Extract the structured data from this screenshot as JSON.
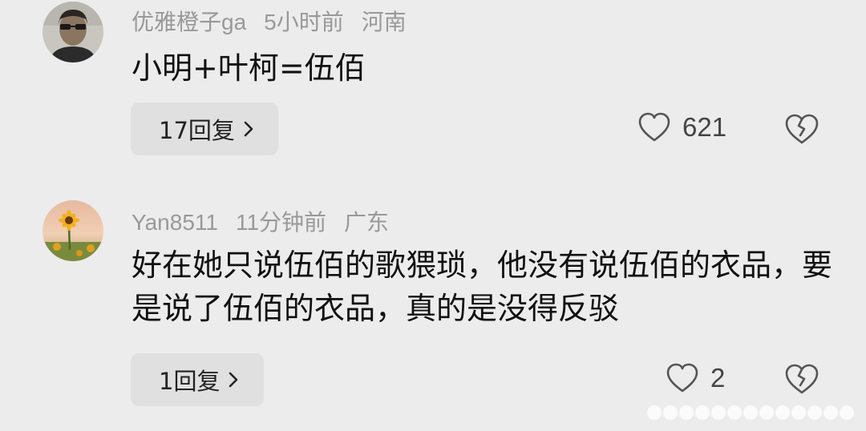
{
  "comments": [
    {
      "username": "优雅橙子ga",
      "time": "5小时前",
      "location": "河南",
      "text": "小明+叶柯=伍佰",
      "reply_label": "17回复",
      "likes": "621",
      "avatar_icon": "man-sunglasses-avatar"
    },
    {
      "username": "Yan8511",
      "time": "11分钟前",
      "location": "广东",
      "text": "好在她只说伍佰的歌猥琐，他没有说伍佰的衣品，要是说了伍佰的衣品，真的是没得反驳",
      "reply_label": "1回复",
      "likes": "2",
      "avatar_icon": "sunflower-avatar"
    }
  ],
  "icons": {
    "like": "heart-outline-icon",
    "dislike": "broken-heart-icon",
    "chevron": "chevron-right-icon"
  },
  "colors": {
    "background": "#ececec",
    "meta_text": "#999999",
    "reply_button_bg": "#e0e0e0"
  }
}
